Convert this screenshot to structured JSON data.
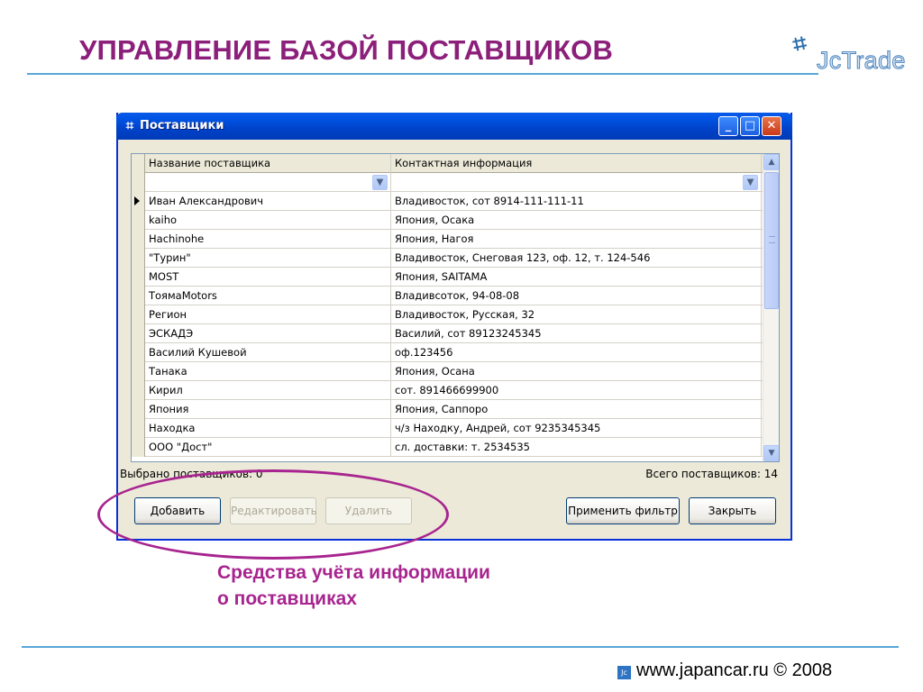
{
  "slide": {
    "title": "УПРАВЛЕНИЕ БАЗОЙ ПОСТАВЩИКОВ",
    "logo_text": "JcTrade",
    "caption_line1": "Средства учёта информации",
    "caption_line2": "о поставщиках",
    "footer_text": "www.japancar.ru © 2008",
    "footer_icon_text": "Jc"
  },
  "window": {
    "title": "Поставщики",
    "icons": {
      "app": "suppliers-app-icon",
      "minimize": "minimize-icon",
      "maximize": "maximize-icon",
      "close": "close-icon"
    }
  },
  "grid": {
    "columns": [
      "Название поставщика",
      "Контактная информация"
    ],
    "rows": [
      [
        "Иван Александрович",
        "Владивосток, сот 8914-111-111-11"
      ],
      [
        "kaiho",
        "Япония, Осака"
      ],
      [
        "Hachinohe",
        "Япония, Нагоя"
      ],
      [
        "\"Турин\"",
        "Владивосток, Снеговая 123, оф. 12, т. 124-546"
      ],
      [
        "MOST",
        "Япония, SAITAMA"
      ],
      [
        "ТоямаMotors",
        "Владивсоток, 94-08-08"
      ],
      [
        "Регион",
        "Владивосток, Русская, 32"
      ],
      [
        "ЭСКАДЭ",
        "Василий, сот 89123245345"
      ],
      [
        "Василий Кушевой",
        "оф.123456"
      ],
      [
        "Танака",
        "Япония, Осана"
      ],
      [
        "Кирил",
        "сот. 891466699900"
      ],
      [
        "Япония",
        "Япония, Саппоро"
      ],
      [
        "Находка",
        "ч/з Находку, Андрей, сот 9235345345"
      ],
      [
        "ООО \"Дост\"",
        "сл. доставки: т. 2534535"
      ]
    ]
  },
  "status": {
    "selected_label": "Выбрано поставщиков: 0",
    "total_label": "Всего поставщиков: 14"
  },
  "buttons": {
    "add": "Добавить",
    "edit": "Редактировать",
    "delete": "Удалить",
    "apply_filter": "Применить фильтр",
    "close": "Закрыть"
  },
  "colors": {
    "title_purple": "#8b1f7a",
    "annotation_magenta": "#a8248f",
    "rule_blue": "#5aa6d8",
    "xp_title_blue": "#0055e5"
  }
}
